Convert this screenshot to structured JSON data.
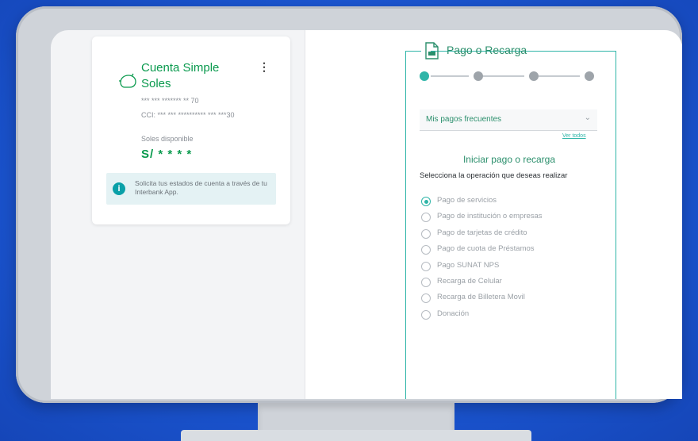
{
  "account": {
    "name_line1": "Cuenta Simple",
    "name_line2": "Soles",
    "menu_icon": "kebab-menu-icon",
    "number": "*** *** ******* ** 70",
    "cci": "CCI: *** *** ********** *** ***30",
    "balance_label": "Soles disponible",
    "balance": "S/ * * * *",
    "info_text": "Solicita tus estados de cuenta a través de tu Interbank App.",
    "info_icon": "info-icon"
  },
  "payment": {
    "title": "Pago o Recarga",
    "title_icon": "document-icon",
    "steps": [
      {
        "state": "active"
      },
      {
        "state": "inactive"
      },
      {
        "state": "inactive"
      },
      {
        "state": "inactive"
      }
    ],
    "dropdown_value": "Mis pagos frecuentes",
    "see_all": "Ver todos",
    "section_title": "Iniciar pago o recarga",
    "section_sub": "Selecciona la operación que deseas realizar",
    "options": [
      {
        "label": "Pago de servicios",
        "selected": true
      },
      {
        "label": "Pago de institución o empresas",
        "selected": false
      },
      {
        "label": "Pago de tarjetas de crédito",
        "selected": false
      },
      {
        "label": "Pago de cuota de Préstamos",
        "selected": false
      },
      {
        "label": "Pago SUNAT NPS",
        "selected": false
      },
      {
        "label": "Recarga de Celular",
        "selected": false
      },
      {
        "label": "Recarga de Billetera Movil",
        "selected": false
      },
      {
        "label": "Donación",
        "selected": false
      }
    ]
  },
  "colors": {
    "brand_green": "#0a9a4e",
    "accent_teal": "#2fb5a8",
    "background_blue": "#1b56d2"
  }
}
